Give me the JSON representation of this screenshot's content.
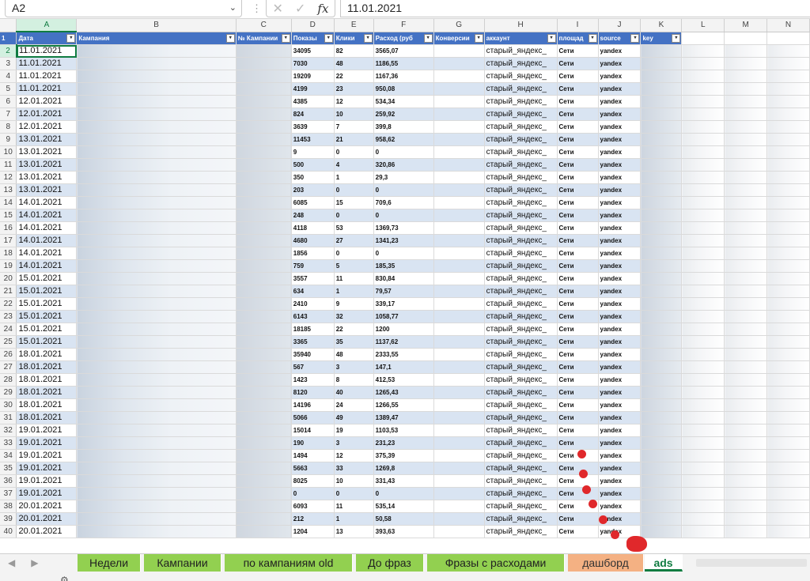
{
  "formula_bar": {
    "name_box": "A2",
    "cancel_glyph": "✕",
    "confirm_glyph": "✓",
    "fx": "fx",
    "value": "11.01.2021"
  },
  "columns": [
    "A",
    "B",
    "C",
    "D",
    "E",
    "F",
    "G",
    "H",
    "I",
    "J",
    "K",
    "L",
    "M",
    "N"
  ],
  "selected_column": "A",
  "header": {
    "row_number": "1",
    "A": "Дата",
    "B": "Кампания",
    "C": "№ Кампании",
    "D": "Показы",
    "E": "Клики",
    "F": "Расход (руб",
    "G": "Конверсии",
    "H": "аккаунт",
    "I": "площад",
    "J": "source",
    "K": "key"
  },
  "rows": [
    {
      "n": "2",
      "date": "11.01.2021",
      "shows": "34095",
      "clicks": "82",
      "cost": "3565,07"
    },
    {
      "n": "3",
      "date": "11.01.2021",
      "shows": "7030",
      "clicks": "48",
      "cost": "1186,55"
    },
    {
      "n": "4",
      "date": "11.01.2021",
      "shows": "19209",
      "clicks": "22",
      "cost": "1167,36"
    },
    {
      "n": "5",
      "date": "11.01.2021",
      "shows": "4199",
      "clicks": "23",
      "cost": "950,08"
    },
    {
      "n": "6",
      "date": "12.01.2021",
      "shows": "4385",
      "clicks": "12",
      "cost": "534,34"
    },
    {
      "n": "7",
      "date": "12.01.2021",
      "shows": "824",
      "clicks": "10",
      "cost": "259,92"
    },
    {
      "n": "8",
      "date": "12.01.2021",
      "shows": "3639",
      "clicks": "7",
      "cost": "399,8"
    },
    {
      "n": "9",
      "date": "13.01.2021",
      "shows": "11453",
      "clicks": "21",
      "cost": "958,62"
    },
    {
      "n": "10",
      "date": "13.01.2021",
      "shows": "9",
      "clicks": "0",
      "cost": "0"
    },
    {
      "n": "11",
      "date": "13.01.2021",
      "shows": "500",
      "clicks": "4",
      "cost": "320,86"
    },
    {
      "n": "12",
      "date": "13.01.2021",
      "shows": "350",
      "clicks": "1",
      "cost": "29,3"
    },
    {
      "n": "13",
      "date": "13.01.2021",
      "shows": "203",
      "clicks": "0",
      "cost": "0"
    },
    {
      "n": "14",
      "date": "14.01.2021",
      "shows": "6085",
      "clicks": "15",
      "cost": "709,6"
    },
    {
      "n": "15",
      "date": "14.01.2021",
      "shows": "248",
      "clicks": "0",
      "cost": "0"
    },
    {
      "n": "16",
      "date": "14.01.2021",
      "shows": "4118",
      "clicks": "53",
      "cost": "1369,73"
    },
    {
      "n": "17",
      "date": "14.01.2021",
      "shows": "4680",
      "clicks": "27",
      "cost": "1341,23"
    },
    {
      "n": "18",
      "date": "14.01.2021",
      "shows": "1856",
      "clicks": "0",
      "cost": "0"
    },
    {
      "n": "19",
      "date": "14.01.2021",
      "shows": "759",
      "clicks": "5",
      "cost": "185,35"
    },
    {
      "n": "20",
      "date": "15.01.2021",
      "shows": "3557",
      "clicks": "11",
      "cost": "830,84"
    },
    {
      "n": "21",
      "date": "15.01.2021",
      "shows": "634",
      "clicks": "1",
      "cost": "79,57"
    },
    {
      "n": "22",
      "date": "15.01.2021",
      "shows": "2410",
      "clicks": "9",
      "cost": "339,17"
    },
    {
      "n": "23",
      "date": "15.01.2021",
      "shows": "6143",
      "clicks": "32",
      "cost": "1058,77"
    },
    {
      "n": "24",
      "date": "15.01.2021",
      "shows": "18185",
      "clicks": "22",
      "cost": "1200"
    },
    {
      "n": "25",
      "date": "15.01.2021",
      "shows": "3365",
      "clicks": "35",
      "cost": "1137,62"
    },
    {
      "n": "26",
      "date": "18.01.2021",
      "shows": "35940",
      "clicks": "48",
      "cost": "2333,55"
    },
    {
      "n": "27",
      "date": "18.01.2021",
      "shows": "567",
      "clicks": "3",
      "cost": "147,1"
    },
    {
      "n": "28",
      "date": "18.01.2021",
      "shows": "1423",
      "clicks": "8",
      "cost": "412,53"
    },
    {
      "n": "29",
      "date": "18.01.2021",
      "shows": "8120",
      "clicks": "40",
      "cost": "1265,43"
    },
    {
      "n": "30",
      "date": "18.01.2021",
      "shows": "14196",
      "clicks": "24",
      "cost": "1266,55"
    },
    {
      "n": "31",
      "date": "18.01.2021",
      "shows": "5066",
      "clicks": "49",
      "cost": "1389,47"
    },
    {
      "n": "32",
      "date": "19.01.2021",
      "shows": "15014",
      "clicks": "19",
      "cost": "1103,53"
    },
    {
      "n": "33",
      "date": "19.01.2021",
      "shows": "190",
      "clicks": "3",
      "cost": "231,23"
    },
    {
      "n": "34",
      "date": "19.01.2021",
      "shows": "1494",
      "clicks": "12",
      "cost": "375,39"
    },
    {
      "n": "35",
      "date": "19.01.2021",
      "shows": "5663",
      "clicks": "33",
      "cost": "1269,8"
    },
    {
      "n": "36",
      "date": "19.01.2021",
      "shows": "8025",
      "clicks": "10",
      "cost": "331,43"
    },
    {
      "n": "37",
      "date": "19.01.2021",
      "shows": "0",
      "clicks": "0",
      "cost": "0"
    },
    {
      "n": "38",
      "date": "20.01.2021",
      "shows": "6093",
      "clicks": "11",
      "cost": "535,14"
    },
    {
      "n": "39",
      "date": "20.01.2021",
      "shows": "212",
      "clicks": "1",
      "cost": "50,58"
    },
    {
      "n": "40",
      "date": "20.01.2021",
      "shows": "1204",
      "clicks": "13",
      "cost": "393,63"
    }
  ],
  "row_constants": {
    "account": "старый_яндекс_",
    "place": "Сети",
    "source": "yandex"
  },
  "sheet_tabs": [
    {
      "label": "Недели",
      "color": "#92d050"
    },
    {
      "label": "Кампании",
      "color": "#92d050"
    },
    {
      "label": "по кампаниям old",
      "color": "#92d050"
    },
    {
      "label": "До фраз",
      "color": "#92d050"
    },
    {
      "label": "Фразы с расходами",
      "color": "#92d050"
    },
    {
      "label": "дашборд",
      "color": "#f4b183"
    },
    {
      "label": "ads",
      "active": true
    }
  ],
  "colors": {
    "header_fill": "#4472c4",
    "stripe": "#d9e4f2",
    "excel_green": "#107c41",
    "annotation_red": "#e0282b"
  },
  "icons": {
    "tab_prev": "◀",
    "tab_next": "▶",
    "settings": "gear-icon",
    "filter": "filter-dropdown-icon"
  }
}
